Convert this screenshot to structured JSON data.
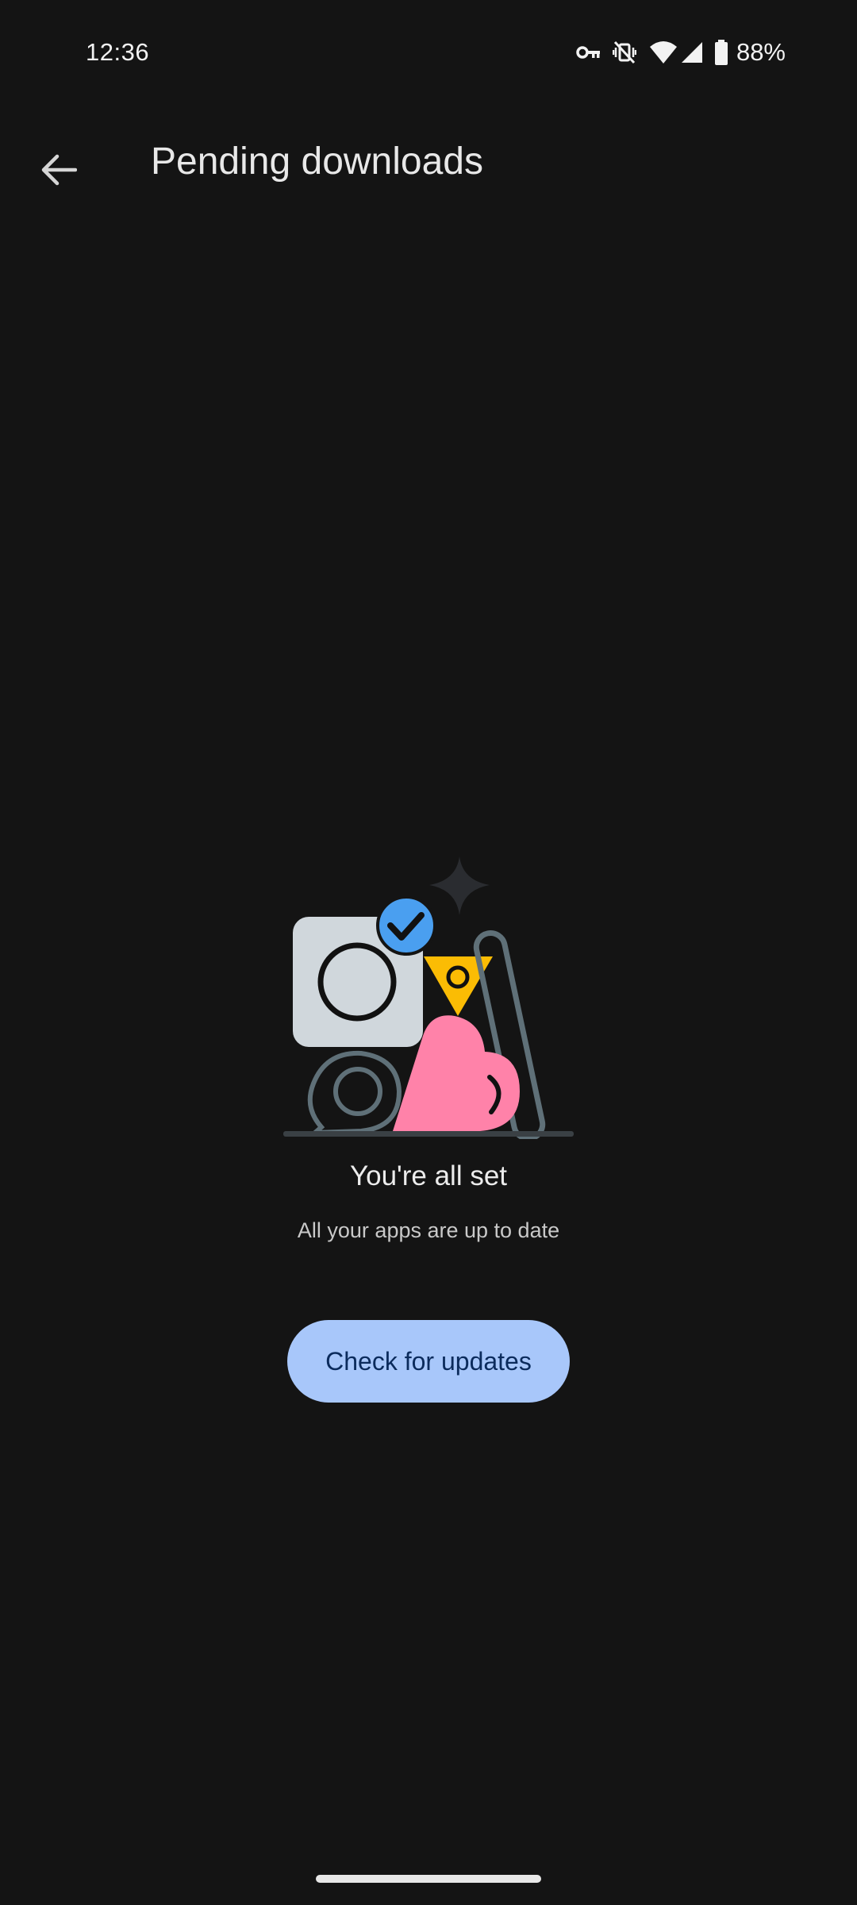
{
  "status_bar": {
    "time": "12:36",
    "battery_percent": "88%",
    "icons": [
      "vpn-key-icon",
      "vibrate-off-icon",
      "wifi-icon",
      "cell-signal-icon",
      "battery-icon"
    ]
  },
  "top_bar": {
    "back_icon": "arrow-back-icon",
    "title": "Pending downloads"
  },
  "empty_state": {
    "illustration": "all-set-illustration",
    "title": "You're all set",
    "subtitle": "All your apps are up to date"
  },
  "actions": {
    "check_updates_label": "Check for updates"
  },
  "colors": {
    "background": "#141414",
    "button_bg": "#a8c7fa",
    "button_text": "#0b2b5c",
    "check_badge": "#4a9ff0",
    "heart_pink": "#ff82a9",
    "triangle_yellow": "#fbbc04",
    "gray_square": "#d0d7dc",
    "outline_gray": "#5f7078"
  }
}
